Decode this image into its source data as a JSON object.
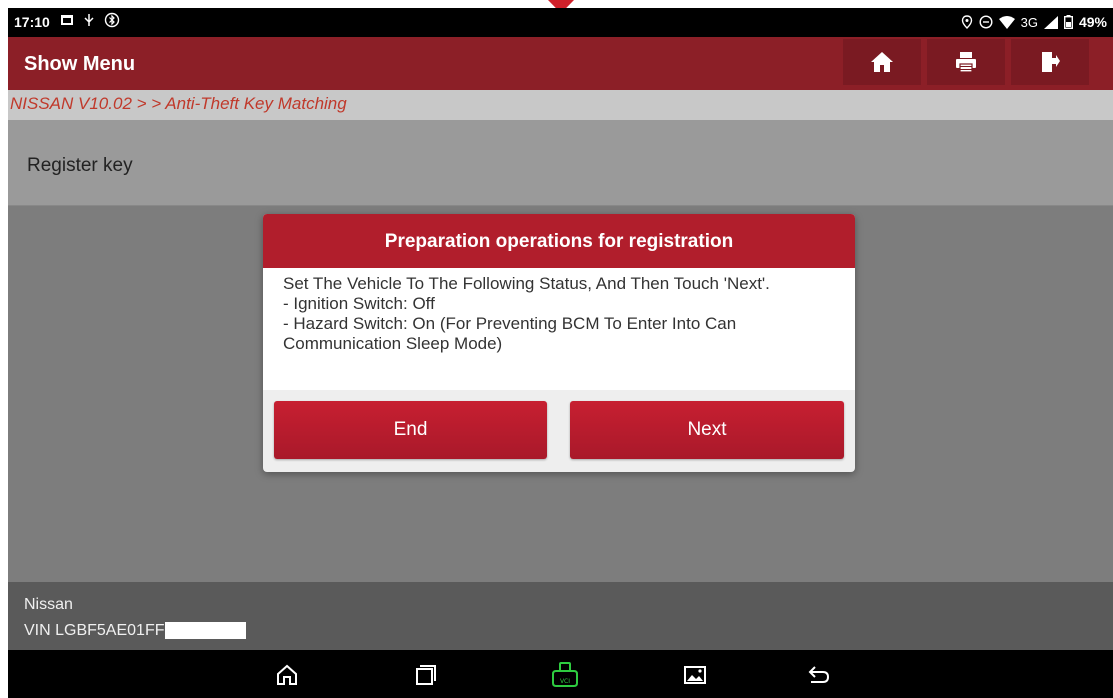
{
  "status_bar": {
    "time": "17:10",
    "network": "3G",
    "battery": "49%"
  },
  "header": {
    "title": "Show Menu"
  },
  "breadcrumb": {
    "text": "NISSAN V10.02 >  > Anti-Theft Key Matching"
  },
  "list": {
    "items": [
      {
        "label": "Register key"
      }
    ]
  },
  "dialog": {
    "title": "Preparation operations for registration",
    "lines": [
      "Set The Vehicle To The Following Status, And Then Touch 'Next'.",
      "- Ignition Switch: Off",
      "- Hazard Switch: On (For Preventing BCM To Enter Into Can Communication Sleep Mode)"
    ],
    "end_label": "End",
    "next_label": "Next"
  },
  "footer": {
    "make": "Nissan",
    "vin": "VIN LGBF5AE01FF"
  },
  "colors": {
    "header": "#8c1f27",
    "accent": "#b11e2c",
    "vci_icon": "#2ecc40"
  }
}
